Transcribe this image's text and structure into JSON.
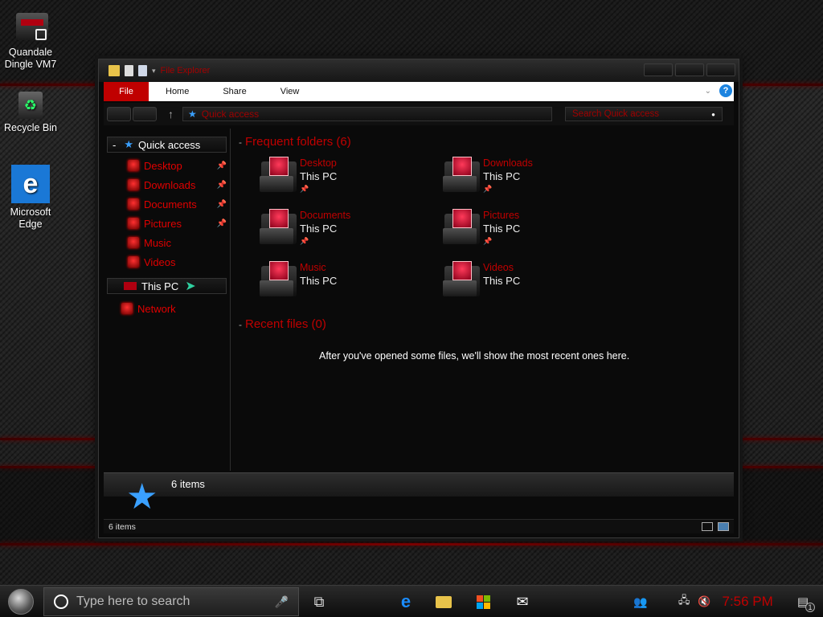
{
  "desktop": {
    "icons": [
      {
        "label": "Quandale\nDingle VM7",
        "icon": "vm-computer-icon"
      },
      {
        "label": "Recycle Bin",
        "icon": "recycle-bin-icon"
      },
      {
        "label": "Microsoft\nEdge",
        "icon": "edge-icon"
      }
    ]
  },
  "window": {
    "title": "File Explorer",
    "ribbon": {
      "file": "File",
      "tabs": [
        "Home",
        "Share",
        "View"
      ],
      "help": "?"
    },
    "address": "Quick access",
    "search_placeholder": "Search Quick access",
    "nav": {
      "quick_access": "Quick access",
      "items": [
        "Desktop",
        "Downloads",
        "Documents",
        "Pictures",
        "Music",
        "Videos"
      ],
      "this_pc": "This PC",
      "network": "Network"
    },
    "frequent_header": "Frequent folders (6)",
    "folders": [
      {
        "name": "Desktop",
        "location": "This PC"
      },
      {
        "name": "Downloads",
        "location": "This PC"
      },
      {
        "name": "Documents",
        "location": "This PC"
      },
      {
        "name": "Pictures",
        "location": "This PC"
      },
      {
        "name": "Music",
        "location": "This PC"
      },
      {
        "name": "Videos",
        "location": "This PC"
      }
    ],
    "recent_header": "Recent files (0)",
    "empty_message": "After you've opened some files, we'll show the most recent ones here.",
    "details_count": "6 items",
    "status_count": "6 items"
  },
  "taskbar": {
    "search_placeholder": "Type here to search",
    "clock": "7:56 PM",
    "notification_count": "1"
  },
  "colors": {
    "accent": "#c00000",
    "blue": "#3aa0ff"
  }
}
